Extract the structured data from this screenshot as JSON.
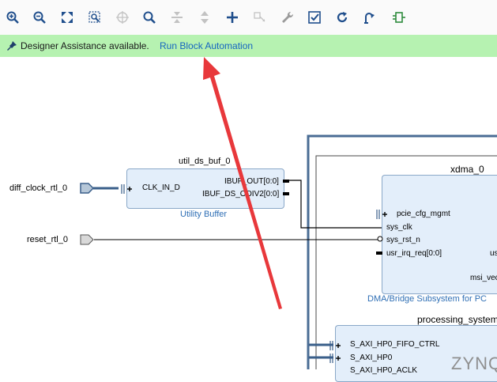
{
  "toolbar": {
    "buttons": [
      {
        "icon": "zoom-in-icon"
      },
      {
        "icon": "zoom-out-icon"
      },
      {
        "icon": "zoom-fit-icon"
      },
      {
        "icon": "zoom-area-icon"
      },
      {
        "icon": "crosshair-icon"
      },
      {
        "icon": "search-icon"
      },
      {
        "icon": "collapse-icon"
      },
      {
        "icon": "expand-icon"
      },
      {
        "icon": "add-ip-icon"
      },
      {
        "icon": "make-connection-icon"
      },
      {
        "icon": "wrench-icon"
      },
      {
        "icon": "validate-icon"
      },
      {
        "icon": "refresh-icon"
      },
      {
        "icon": "regenerate-layout-icon"
      },
      {
        "icon": "ip-block-icon"
      }
    ]
  },
  "banner": {
    "message": "Designer Assistance available.",
    "link": "Run Block Automation",
    "bg_color": "#b6f2b1",
    "link_color": "#1565c0"
  },
  "ports": {
    "diff_clock": "diff_clock_rtl_0",
    "reset": "reset_rtl_0"
  },
  "util_ds_buf": {
    "name": "util_ds_buf_0",
    "subtitle": "Utility Buffer",
    "pin_in": "CLK_IN_D",
    "pin_out1": "IBUF_OUT[0:0]",
    "pin_out2": "IBUF_DS_ODIV2[0:0]"
  },
  "xdma": {
    "name": "xdma_0",
    "subtitle": "DMA/Bridge Subsystem for PC",
    "pins": [
      "pcie_cfg_mgmt",
      "sys_clk",
      "sys_rst_n",
      "usr_irq_req[0:0]"
    ],
    "right_pins": [
      "us",
      "msi_vec"
    ]
  },
  "processing_system": {
    "name": "processing_system",
    "pins": [
      "S_AXI_HP0_FIFO_CTRL",
      "S_AXI_HP0",
      "S_AXI_HP0_ACLK"
    ],
    "logo": "ZYNQ"
  },
  "annotation": {
    "color": "#e8383b"
  }
}
